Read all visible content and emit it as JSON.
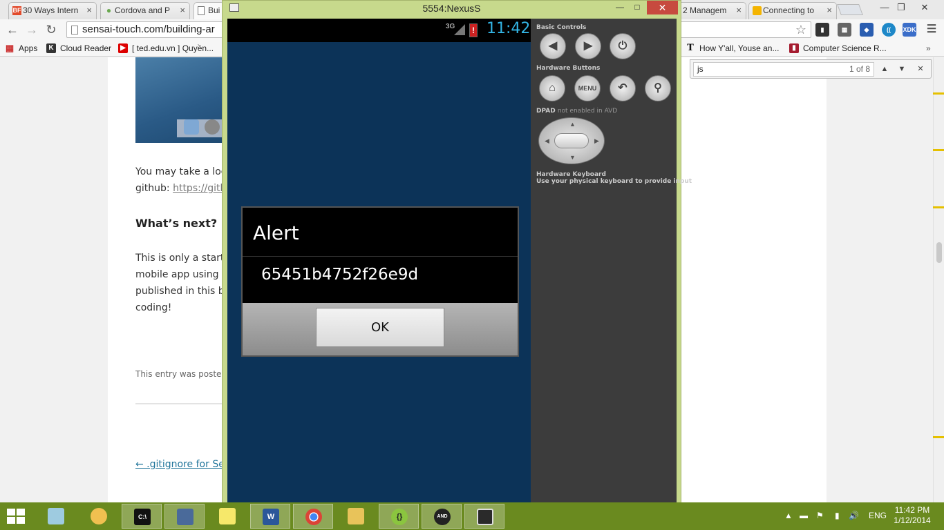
{
  "browser": {
    "tabs": [
      {
        "favicon": "BF",
        "title": "30 Ways Intern",
        "active": false
      },
      {
        "favicon": "leaf-icon",
        "title": "Cordova and P",
        "active": false
      },
      {
        "favicon": "page-icon",
        "title": "Bui",
        "active": true
      },
      {
        "favicon": "",
        "title": "2 Managem",
        "active": false
      },
      {
        "favicon": "box-icon",
        "title": "Connecting to",
        "active": false
      }
    ],
    "url": "sensai-touch.com/building-ar",
    "bookmarks": [
      {
        "icon": "apps-icon",
        "label": "Apps"
      },
      {
        "icon": "K",
        "label": "Cloud Reader"
      },
      {
        "icon": "youtube-icon",
        "label": "[ ted.edu.vn ] Quyền..."
      },
      {
        "icon": "nyt-icon",
        "label": "How Y'all, Youse an..."
      },
      {
        "icon": "harvard-icon",
        "label": "Computer Science R..."
      }
    ],
    "find": {
      "query": "js",
      "count": "1 of 8"
    }
  },
  "page": {
    "para1_line1": "You may take a loo",
    "para1_line2_prefix": "github: ",
    "para1_link": "https://gith",
    "heading": "What’s next?",
    "para2_lines": [
      "This is only a start.",
      "mobile app using s",
      "published in this b",
      "coding!"
    ],
    "meta": "This entry was posted",
    "prev_link": "← .gitignore for Se"
  },
  "emulator": {
    "title": "5554:NexusS",
    "status": {
      "network": "3G",
      "time": "11:42"
    },
    "dialog": {
      "title": "Alert",
      "message": "65451b4752f26e9d",
      "ok_label": "OK"
    },
    "controls": {
      "basic_title": "Basic Controls",
      "hardware_title": "Hardware Buttons",
      "menu_label": "MENU",
      "dpad_note_bold": "DPAD",
      "dpad_note": "not enabled in AVD",
      "keyboard_title": "Hardware Keyboard",
      "keyboard_note": "Use your physical keyboard to provide input"
    }
  },
  "taskbar": {
    "language": "ENG",
    "time": "11:42 PM",
    "date": "1/12/2014",
    "apps": [
      "explorer-tile",
      "paint",
      "cmd",
      "remote",
      "sticky-notes",
      "word",
      "chrome",
      "file-explorer",
      "brackets",
      "android-emulator",
      "window"
    ]
  },
  "colors": {
    "taskbar": "#6a8a1f",
    "emulator_frame": "#c7d98c",
    "android_bg": "#0c3358",
    "status_time": "#33b5e5",
    "find_marker": "#e5c000"
  }
}
